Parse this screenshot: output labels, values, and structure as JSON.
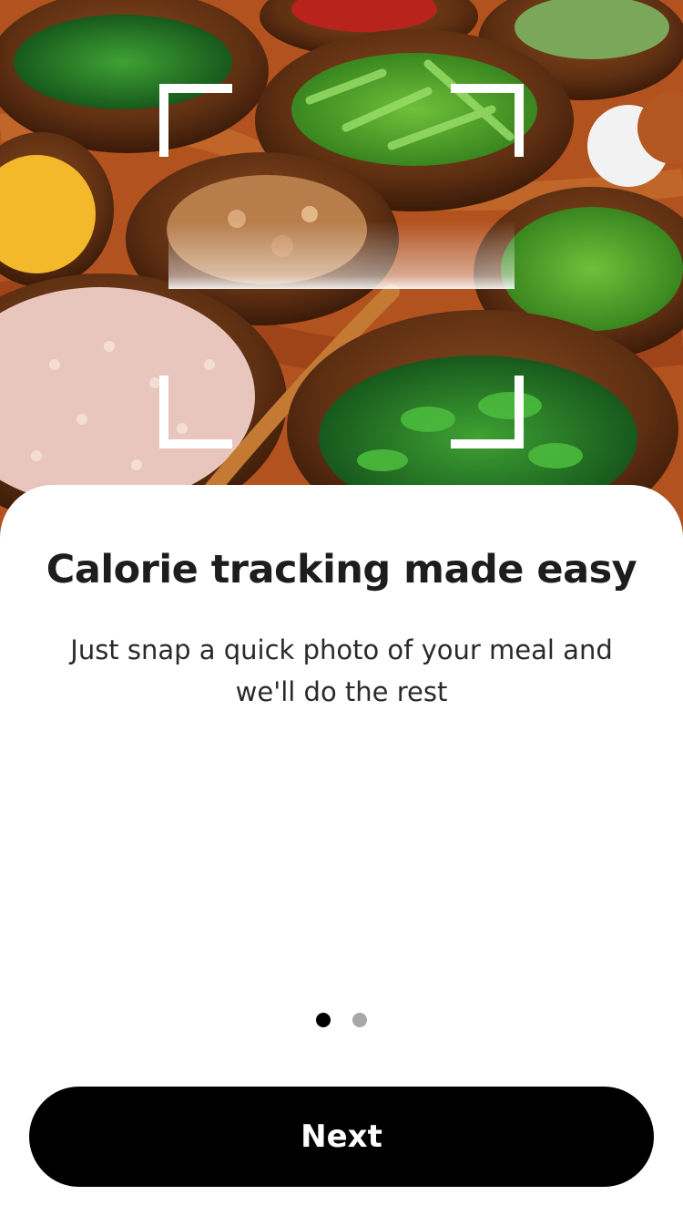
{
  "hero": {
    "image": "food-bowls-photo",
    "scan_frame_icon": "camera-scan-frame-icon"
  },
  "onboarding": {
    "title": "Calorie tracking made easy",
    "subtitle_line1": "Just snap a quick photo of your meal and",
    "subtitle_line2": "we'll do the rest"
  },
  "pagination": {
    "total": 2,
    "current": 1
  },
  "actions": {
    "next_label": "Next"
  },
  "colors": {
    "primary": "#000000",
    "background": "#ffffff",
    "inactive_dot": "#a8a8a8"
  }
}
